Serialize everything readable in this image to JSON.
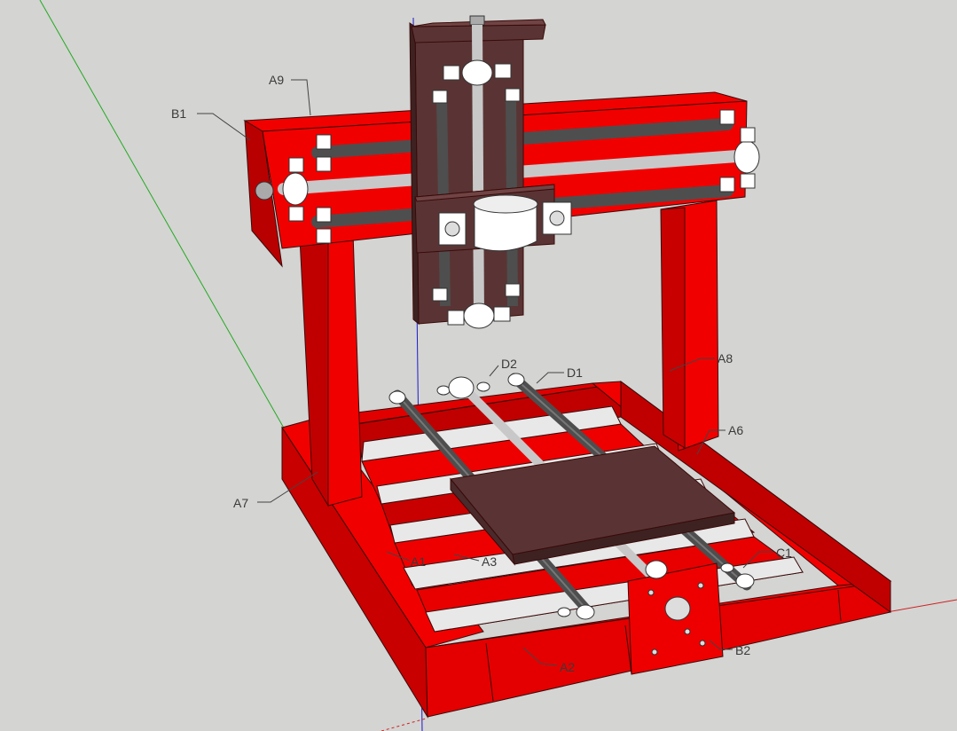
{
  "labels": {
    "a9": "A9",
    "b1": "B1",
    "d2": "D2",
    "d1": "D1",
    "a8": "A8",
    "a6": "A6",
    "a7": "A7",
    "a1": "A1",
    "a3": "A3",
    "a2": "A2",
    "c1": "C1",
    "b2": "B2"
  },
  "colors": {
    "background": "#d4d4d2",
    "frame_red": "#f10000",
    "frame_red_dark": "#b40000",
    "frame_red_side": "#d20000",
    "plate_brown": "#5a3434",
    "rod_grey": "#4e4e4e",
    "rod_light": "#c8c8c8",
    "bracket_white": "#ffffff",
    "axis_blue": "#1a1acc",
    "axis_green": "#22aa22",
    "axis_red": "#cc2222"
  }
}
